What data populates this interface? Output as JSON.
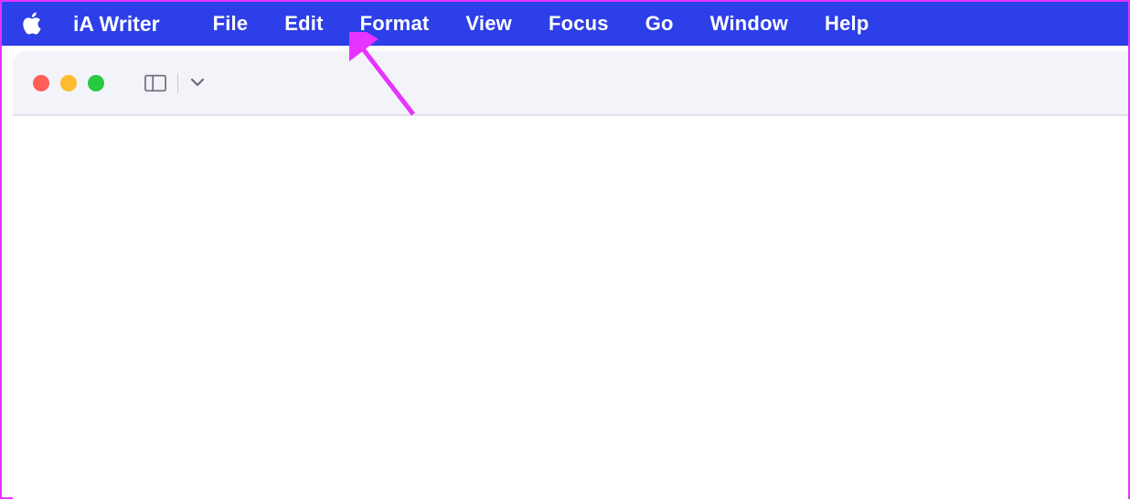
{
  "menubar": {
    "app_name": "iA Writer",
    "items": [
      {
        "label": "File"
      },
      {
        "label": "Edit"
      },
      {
        "label": "Format"
      },
      {
        "label": "View"
      },
      {
        "label": "Focus"
      },
      {
        "label": "Go"
      },
      {
        "label": "Window"
      },
      {
        "label": "Help"
      }
    ]
  },
  "colors": {
    "menubar_bg": "#2d3fe8",
    "annotation": "#e633ff",
    "traffic_red": "#ff5f57",
    "traffic_yellow": "#febc2e",
    "traffic_green": "#28c840"
  }
}
